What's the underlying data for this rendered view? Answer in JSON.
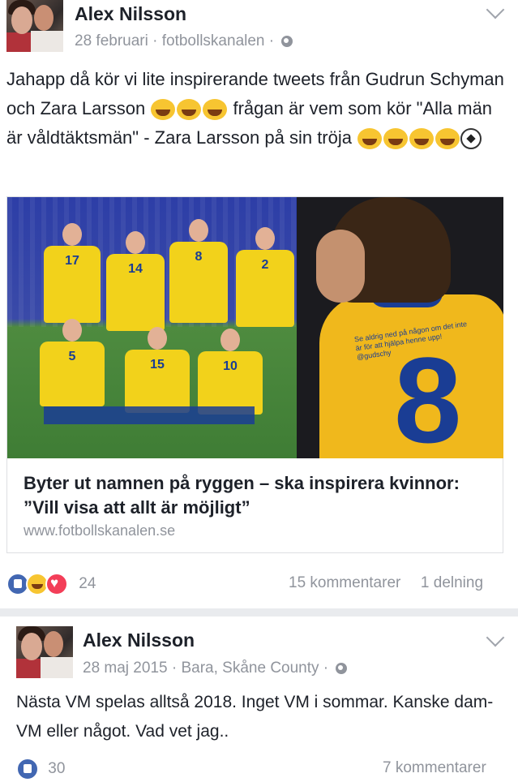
{
  "post1": {
    "author": "Alex Nilsson",
    "date": "28 februari",
    "source": "fotbollskanalen",
    "text": "Jahapp då kör vi lite inspirerande tweets från Gudrun Schyman och Zara Larsson",
    "text_middle": " frågan är vem som kör \"Alla män är våldtäktsmän\" - Zara Larsson på sin tröja",
    "link": {
      "title": "Byter ut namnen på ryggen – ska inspirera kvinnor: ”Vill visa att allt är möjligt”",
      "domain": "www.fotbollskanalen.se",
      "jersey_quote": "Se aldrig ned på någon om det inte är för att hjälpa henne upp!",
      "jersey_handle": "@gudschy",
      "jersey_number": "8",
      "player_numbers": [
        "17",
        "14",
        "8",
        "2",
        "5",
        "15",
        "10"
      ]
    },
    "reactions": {
      "icons": [
        "like-icon",
        "haha-icon",
        "love-icon"
      ],
      "count": "24"
    },
    "comments": "15 kommentarer",
    "shares": "1 delning"
  },
  "post2": {
    "author": "Alex Nilsson",
    "date": "28 maj 2015",
    "location": "Bara, Skåne County",
    "text": "Nästa VM spelas alltså 2018. Inget VM i sommar. Kanske dam-VM eller något. Vad vet jag..",
    "reactions": {
      "icons": [
        "like-icon"
      ],
      "count": "30"
    },
    "comments": "7 kommentarer"
  },
  "colors": {
    "text": "#1d2129",
    "meta": "#90949c",
    "like_blue": "#4267b2",
    "jersey_yellow": "#f2d21b",
    "jersey_blue": "#1a3d94"
  }
}
